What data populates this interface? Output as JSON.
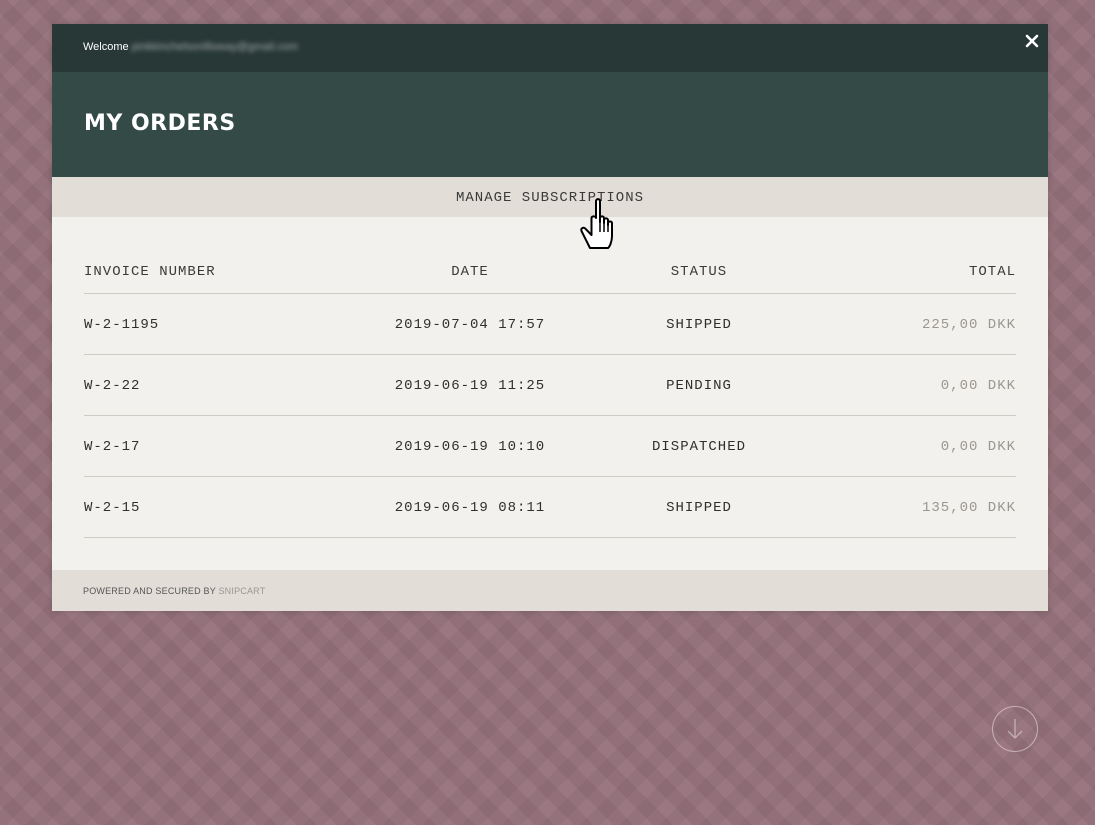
{
  "topbar": {
    "welcome_label": "Welcome",
    "email_blurred": "pinkkinchelsonllloway@gmail.com"
  },
  "header": {
    "title": "MY ORDERS"
  },
  "subnav": {
    "manage_subscriptions": "MANAGE SUBSCRIPTIONS"
  },
  "orders": {
    "columns": {
      "invoice": "INVOICE NUMBER",
      "date": "DATE",
      "status": "STATUS",
      "total": "TOTAL"
    },
    "rows": [
      {
        "invoice": "W-2-1195",
        "date": "2019-07-04 17:57",
        "status": "SHIPPED",
        "total": "225,00 DKK"
      },
      {
        "invoice": "W-2-22",
        "date": "2019-06-19 11:25",
        "status": "PENDING",
        "total": "0,00 DKK"
      },
      {
        "invoice": "W-2-17",
        "date": "2019-06-19 10:10",
        "status": "DISPATCHED",
        "total": "0,00 DKK"
      },
      {
        "invoice": "W-2-15",
        "date": "2019-06-19 08:11",
        "status": "SHIPPED",
        "total": "135,00 DKK"
      }
    ]
  },
  "footer": {
    "powered_text": "POWERED AND SECURED BY",
    "brand": "SNIPCART"
  },
  "icons": {
    "close": "close-icon",
    "cursor": "hand-pointer-icon",
    "scroll": "arrow-down-circle-icon"
  },
  "colors": {
    "backdrop": "#94707a",
    "topbar": "#283837",
    "header": "#344a47",
    "panel": "#f3f1ee",
    "band": "#e2ddd7"
  }
}
